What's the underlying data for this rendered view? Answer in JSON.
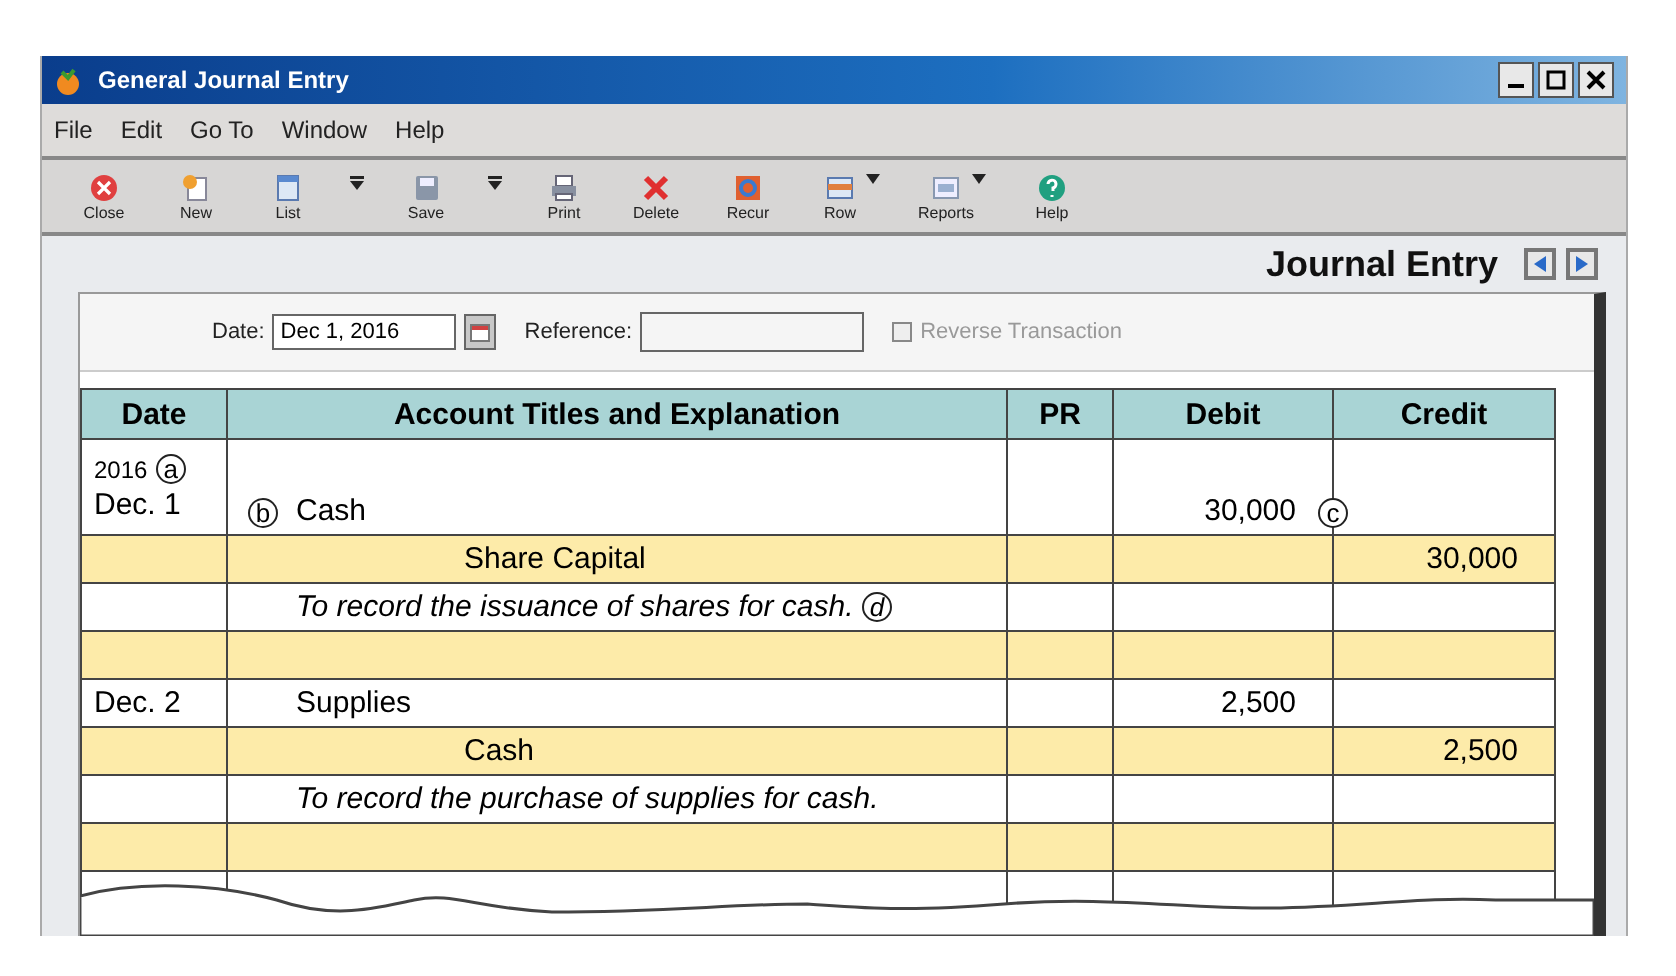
{
  "window": {
    "title": "General Journal Entry"
  },
  "menu": [
    "File",
    "Edit",
    "Go To",
    "Window",
    "Help"
  ],
  "toolbar": [
    {
      "label": "Close",
      "kind": "plain"
    },
    {
      "label": "New",
      "kind": "plain"
    },
    {
      "label": "List",
      "kind": "split"
    },
    {
      "label": "Save",
      "kind": "split"
    },
    {
      "label": "Print",
      "kind": "plain"
    },
    {
      "label": "Delete",
      "kind": "plain"
    },
    {
      "label": "Recur",
      "kind": "plain"
    },
    {
      "label": "Row",
      "kind": "menu"
    },
    {
      "label": "Reports",
      "kind": "menu"
    },
    {
      "label": "Help",
      "kind": "plain"
    }
  ],
  "header": {
    "title": "Journal Entry"
  },
  "form": {
    "date_label": "Date:",
    "date_value": "Dec 1, 2016",
    "reference_label": "Reference:",
    "reverse": {
      "label": "Reverse Transaction",
      "checked": false,
      "disabled": true
    }
  },
  "table": {
    "columns": [
      "Date",
      "Account Titles and Explanation",
      "PR",
      "Debit",
      "Credit"
    ],
    "rows": [
      {
        "kind": "entry",
        "date": [
          "2016",
          "Dec. 1"
        ],
        "date_note": "a",
        "account": "Cash",
        "account_note": "b",
        "debit": "30,000",
        "debit_note": "c"
      },
      {
        "kind": "credit",
        "account": "Share Capital",
        "credit": "30,000"
      },
      {
        "kind": "explanation",
        "account": "To record the issuance of shares for cash.",
        "account_note": "d"
      },
      {
        "kind": "blank"
      },
      {
        "kind": "entry",
        "date": [
          "Dec. 2"
        ],
        "account": "Supplies",
        "debit": "2,500"
      },
      {
        "kind": "credit",
        "account": "Cash",
        "credit": "2,500"
      },
      {
        "kind": "explanation",
        "account": "To record the purchase of supplies for cash."
      },
      {
        "kind": "blank"
      },
      {
        "kind": "blank"
      }
    ]
  }
}
